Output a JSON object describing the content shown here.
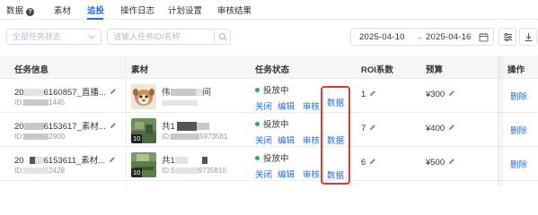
{
  "tabs": [
    {
      "label": "数据",
      "active": false
    },
    {
      "label": "素材",
      "active": false
    },
    {
      "label": "追投",
      "active": true
    },
    {
      "label": "操作日志",
      "active": false
    },
    {
      "label": "计划设置",
      "active": false
    },
    {
      "label": "审核结果",
      "active": false
    }
  ],
  "filters": {
    "status_select": "全部任务状态",
    "search_placeholder": "请输入任务ID/名称",
    "date_start": "2025-04-10",
    "date_arrow": "→",
    "date_end": "2025-04-16"
  },
  "table": {
    "headers": {
      "task_info": "任务信息",
      "material": "素材",
      "task_status": "任务状态",
      "roi": "ROI系数",
      "budget": "预算",
      "operation": "操作"
    },
    "rows": [
      {
        "task_name_prefix": "20",
        "task_name_suffix": "6160857_直播...",
        "task_id_prefix": "ID:",
        "task_id_suffix": "1445",
        "material_name_prefix": "伟",
        "material_name_suffix": "间",
        "material_id_prefix": "",
        "material_id_suffix": "",
        "thumb_badge": "",
        "status": "投放中",
        "actions": [
          "关闭",
          "编辑",
          "审核",
          "数据"
        ],
        "roi": "1",
        "budget": "¥300",
        "delete": "删除"
      },
      {
        "task_name_prefix": "20",
        "task_name_suffix": "6153617_素材...",
        "task_id_prefix": "ID:",
        "task_id_suffix": "2900",
        "material_name_prefix": "共1",
        "material_name_suffix": "",
        "material_id_prefix": "ID:",
        "material_id_suffix": "5973581",
        "thumb_badge": "10",
        "status": "投放中",
        "actions": [
          "关闭",
          "编辑",
          "审核",
          "数据"
        ],
        "roi": "7",
        "budget": "¥400",
        "delete": "删除"
      },
      {
        "task_name_prefix": "20",
        "task_name_suffix": "6153611_素材...",
        "task_id_prefix": "ID:",
        "task_id_suffix": "2428",
        "material_name_prefix": "共1",
        "material_name_suffix": "",
        "material_id_prefix": "ID:5",
        "material_id_suffix": "9735810",
        "thumb_badge": "10",
        "status": "投放中",
        "actions": [
          "关闭",
          "编辑",
          "审核",
          "数据"
        ],
        "roi": "6",
        "budget": "¥500",
        "delete": "删除"
      }
    ]
  },
  "colors": {
    "accent": "#1f6feb",
    "status_active": "#27b148",
    "highlight": "#e53927",
    "header_bg": "#f5f6f8"
  },
  "icons": [
    "help-icon",
    "chevron-down-icon",
    "search-icon",
    "calendar-icon",
    "column-settings-icon",
    "download-icon",
    "pencil-icon"
  ]
}
